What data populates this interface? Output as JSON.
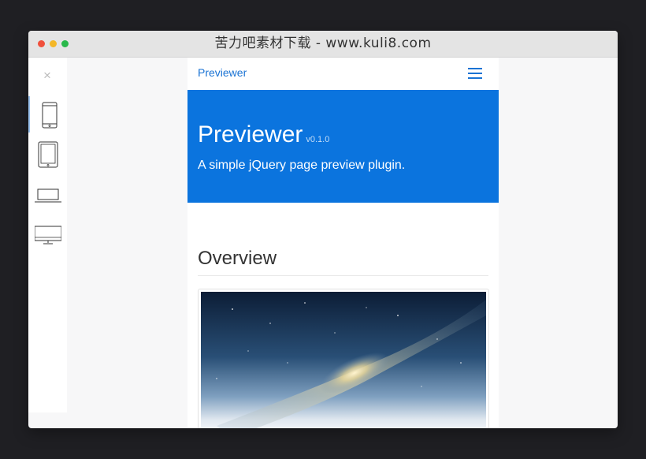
{
  "window": {
    "title": "苦力吧素材下载 - www.kuli8.com",
    "colors": {
      "close": "#f0503c",
      "minimize": "#f4b727",
      "zoom": "#29b84a"
    }
  },
  "device_bar": {
    "close_symbol": "×",
    "devices": [
      {
        "name": "phone",
        "icon": "smartphone-icon",
        "active": true
      },
      {
        "name": "tablet",
        "icon": "tablet-icon",
        "active": false
      },
      {
        "name": "laptop",
        "icon": "laptop-icon",
        "active": false
      },
      {
        "name": "desktop",
        "icon": "desktop-monitor-icon",
        "active": false
      }
    ]
  },
  "preview": {
    "navbar": {
      "brand": "Previewer",
      "menu_icon": "hamburger-menu-icon"
    },
    "hero": {
      "title": "Previewer",
      "version": "v0.1.0",
      "subtitle": "A simple jQuery page preview plugin.",
      "background": "#0b74de"
    },
    "overview": {
      "heading": "Overview",
      "image": "galaxy-screenshot-image"
    },
    "accent_color": "#1a73d4"
  }
}
